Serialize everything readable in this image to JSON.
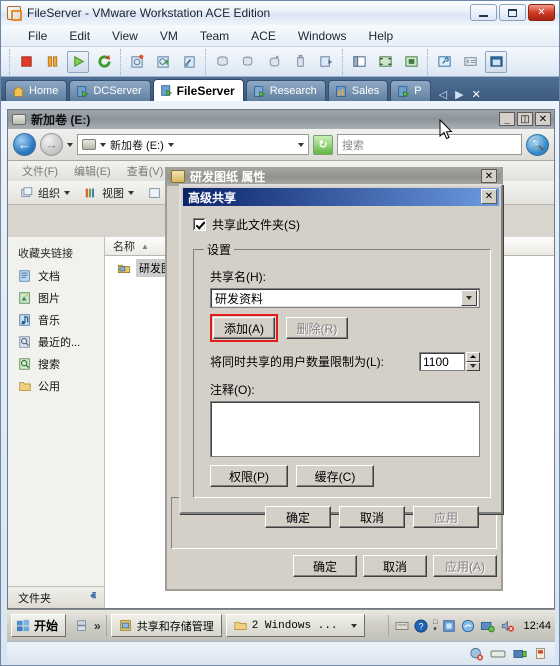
{
  "vmware": {
    "title": "FileServer - VMware Workstation ACE Edition",
    "app_icon": "vmware-icon",
    "window_buttons": [
      {
        "name": "minimize-button",
        "label": "–"
      },
      {
        "name": "maximize-button",
        "label": "□"
      },
      {
        "name": "close-button",
        "label": "✕"
      }
    ],
    "menu": [
      "File",
      "Edit",
      "View",
      "VM",
      "Team",
      "ACE",
      "Windows",
      "Help"
    ],
    "toolbar_groups": [
      [
        "power-off-icon",
        "suspend-icon",
        "power-on-icon",
        "reset-icon"
      ],
      [
        "snapshot-take-icon",
        "snapshot-revert-icon",
        "snapshot-manager-icon"
      ],
      [
        "clone-icon",
        "clone-multiple-icon",
        "delete-vm-icon",
        "usb-device-icon",
        "send-ctrl-alt-del-icon"
      ],
      [
        "show-sidebar-icon",
        "fullscreen-icon",
        "quick-switch-icon"
      ],
      [
        "preferences-icon",
        "summary-view-icon",
        "console-view-icon"
      ]
    ],
    "tabs": [
      {
        "name": "tab-home",
        "label": "Home",
        "icon": "home-icon",
        "selected": false
      },
      {
        "name": "tab-dcserver",
        "label": "DCServer",
        "icon": "vm-icon",
        "selected": false
      },
      {
        "name": "tab-fileserver",
        "label": "FileServer",
        "icon": "vm-icon",
        "selected": true
      },
      {
        "name": "tab-research",
        "label": "Research",
        "icon": "team-vm-icon",
        "selected": false
      },
      {
        "name": "tab-sales",
        "label": "Sales",
        "icon": "team-icon",
        "selected": false
      },
      {
        "name": "tab-p",
        "label": "P",
        "icon": "vm-icon",
        "selected": false
      }
    ],
    "tab_nav": [
      {
        "name": "tab-scroll-left-icon",
        "label": "◁"
      },
      {
        "name": "tab-scroll-right-icon",
        "label": "▶"
      },
      {
        "name": "tab-close-icon",
        "label": "✕"
      }
    ]
  },
  "explorer": {
    "title": "新加卷 (E:)",
    "window_buttons": [
      {
        "name": "explorer-minimize-button",
        "label": "_"
      },
      {
        "name": "explorer-restore-button",
        "label": "◫"
      },
      {
        "name": "explorer-close-button",
        "label": "✕"
      }
    ],
    "address": "新加卷 (E:)",
    "search_placeholder": "搜索",
    "menu": [
      "文件(F)",
      "编辑(E)",
      "查看(V)"
    ],
    "toolbar": [
      {
        "name": "organize-button",
        "label": "组织",
        "icon": "organize-icon"
      },
      {
        "name": "views-button",
        "label": "视图",
        "icon": "views-icon"
      }
    ],
    "sidebar_title": "收藏夹链接",
    "sidebar_items": [
      {
        "name": "sidebar-item-documents",
        "label": "文档",
        "icon": "documents-icon",
        "color": "#6fa8d8"
      },
      {
        "name": "sidebar-item-pictures",
        "label": "图片",
        "icon": "pictures-icon",
        "color": "#62b06a"
      },
      {
        "name": "sidebar-item-music",
        "label": "音乐",
        "icon": "music-icon",
        "color": "#5b9bd5"
      },
      {
        "name": "sidebar-item-recent",
        "label": "最近的...",
        "icon": "recent-icon",
        "color": "#8fa9c4"
      },
      {
        "name": "sidebar-item-search",
        "label": "搜索",
        "icon": "search-folder-icon",
        "color": "#7fba63"
      },
      {
        "name": "sidebar-item-public",
        "label": "公用",
        "icon": "public-folder-icon",
        "color": "#e8c25a"
      }
    ],
    "folders_label": "文件夹",
    "folders_chevron": "ⱏ",
    "list_header": "名称",
    "list_sort_glyph": "▲",
    "list_items": [
      {
        "name": "list-item-folder",
        "label": "研发图纸",
        "icon": "shared-folder-icon"
      }
    ]
  },
  "properties_dialog": {
    "title": "研发图纸 属性",
    "icon": "shared-folder-icon",
    "close_label": "✕",
    "buttons": [
      {
        "name": "prop-ok-button",
        "label": "确定",
        "disabled": false
      },
      {
        "name": "prop-cancel-button",
        "label": "取消",
        "disabled": false
      },
      {
        "name": "prop-apply-button",
        "label": "应用(A)",
        "disabled": true
      }
    ]
  },
  "advanced_sharing": {
    "title": "高级共享",
    "close_label": "✕",
    "share_checkbox": {
      "label": "共享此文件夹(S)",
      "checked": true
    },
    "settings_legend": "设置",
    "share_name_label": "共享名(H):",
    "share_name_value": "研发资料",
    "add_button": {
      "label": "添加(A)",
      "highlighted": true
    },
    "remove_button": {
      "label": "删除(R)",
      "disabled": true
    },
    "limit_label": "将同时共享的用户数量限制为(L):",
    "limit_value": "1100",
    "comment_label": "注释(O):",
    "comment_value": "",
    "permissions_button": "权限(P)",
    "caching_button": "缓存(C)",
    "footer_buttons": [
      {
        "name": "adv-ok-button",
        "label": "确定",
        "disabled": false
      },
      {
        "name": "adv-cancel-button",
        "label": "取消",
        "disabled": false
      },
      {
        "name": "adv-apply-button",
        "label": "应用",
        "disabled": true
      }
    ],
    "highlight_color": "#e21b1b"
  },
  "taskbar": {
    "start_label": "开始",
    "quicklaunch_overflow": "»",
    "tasks": [
      {
        "name": "taskbar-item-share-storage",
        "label": "共享和存储管理",
        "icon": "server-manager-icon"
      },
      {
        "name": "taskbar-item-windows-group",
        "label": "2 Windows ...",
        "icon": "folder-icon",
        "group": true
      }
    ],
    "tray_icons": [
      "keyboard-icon",
      "help-icon",
      "network-icon",
      "security-icon",
      "network-status-icon",
      "volume-muted-icon"
    ],
    "clock": "12:44"
  },
  "status_strip": {
    "icons": [
      "disk-activity-icon",
      "removable-device-icon",
      "network-adapter-icon",
      "usb-icon"
    ]
  }
}
